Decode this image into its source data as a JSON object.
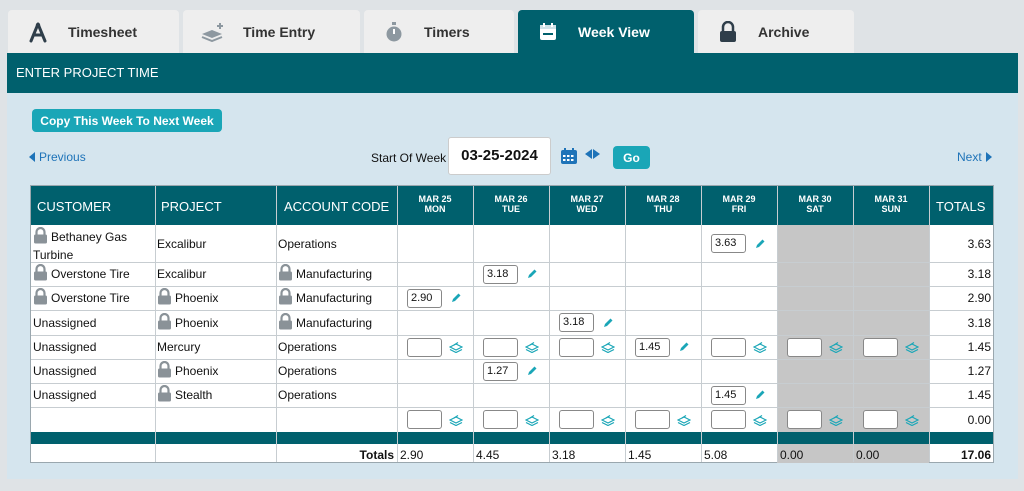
{
  "tabs": [
    {
      "label": "Timesheet",
      "icon": "compass-icon",
      "active": false
    },
    {
      "label": "Time Entry",
      "icon": "stack-plus-icon",
      "active": false
    },
    {
      "label": "Timers",
      "icon": "stopwatch-icon",
      "active": false
    },
    {
      "label": "Week View",
      "icon": "calendar-icon",
      "active": true
    },
    {
      "label": "Archive",
      "icon": "lock-icon",
      "active": false
    }
  ],
  "header": {
    "title": "ENTER PROJECT TIME"
  },
  "toolbar": {
    "copy_label": "Copy This Week To Next Week",
    "prev_label": "Previous",
    "next_label": "Next",
    "start_label": "Start Of Week",
    "start_date": "03-25-2024",
    "go_label": "Go"
  },
  "table": {
    "headers": {
      "customer": "CUSTOMER",
      "project": "PROJECT",
      "account": "ACCOUNT CODE",
      "totals": "TOTALS"
    },
    "days": [
      {
        "date": "MAR 25",
        "dow": "MON"
      },
      {
        "date": "MAR 26",
        "dow": "TUE"
      },
      {
        "date": "MAR 27",
        "dow": "WED"
      },
      {
        "date": "MAR 28",
        "dow": "THU"
      },
      {
        "date": "MAR 29",
        "dow": "FRI"
      },
      {
        "date": "MAR 30",
        "dow": "SAT"
      },
      {
        "date": "MAR 31",
        "dow": "SUN"
      }
    ],
    "rows": [
      {
        "customer": "Bethaney Gas Turbine",
        "customer_locked": true,
        "project": "Excalibur",
        "project_locked": false,
        "account": "Operations",
        "account_locked": false,
        "entries": {
          "4": "3.63"
        },
        "empty_inputs": [],
        "total": "3.63"
      },
      {
        "customer": "Overstone Tire",
        "customer_locked": true,
        "project": "Excalibur",
        "project_locked": false,
        "account": "Manufacturing",
        "account_locked": true,
        "entries": {
          "1": "3.18"
        },
        "empty_inputs": [],
        "total": "3.18"
      },
      {
        "customer": "Overstone Tire",
        "customer_locked": true,
        "project": "Phoenix",
        "project_locked": true,
        "account": "Manufacturing",
        "account_locked": true,
        "entries": {
          "0": "2.90"
        },
        "empty_inputs": [],
        "total": "2.90"
      },
      {
        "customer": "Unassigned",
        "customer_locked": false,
        "project": "Phoenix",
        "project_locked": true,
        "account": "Manufacturing",
        "account_locked": true,
        "entries": {
          "2": "3.18"
        },
        "empty_inputs": [],
        "total": "3.18"
      },
      {
        "customer": "Unassigned",
        "customer_locked": false,
        "project": "Mercury",
        "project_locked": false,
        "account": "Operations",
        "account_locked": false,
        "entries": {
          "3": "1.45"
        },
        "empty_inputs": [
          0,
          1,
          2,
          4,
          5,
          6
        ],
        "total": "1.45"
      },
      {
        "customer": "Unassigned",
        "customer_locked": false,
        "project": "Phoenix",
        "project_locked": true,
        "account": "Operations",
        "account_locked": false,
        "entries": {
          "1": "1.27"
        },
        "empty_inputs": [],
        "total": "1.27"
      },
      {
        "customer": "Unassigned",
        "customer_locked": false,
        "project": "Stealth",
        "project_locked": true,
        "account": "Operations",
        "account_locked": false,
        "entries": {
          "4": "1.45"
        },
        "empty_inputs": [],
        "total": "1.45"
      },
      {
        "customer": "",
        "customer_locked": false,
        "project": "",
        "project_locked": false,
        "account": "",
        "account_locked": false,
        "entries": {},
        "empty_inputs": [
          0,
          1,
          2,
          3,
          4,
          5,
          6
        ],
        "total": "0.00"
      }
    ],
    "footer": {
      "label": "Totals",
      "values": [
        "2.90",
        "4.45",
        "3.18",
        "1.45",
        "5.08",
        "0.00",
        "0.00"
      ],
      "grand_total": "17.06"
    }
  },
  "colors": {
    "teal": "#00606d",
    "button": "#1aa6b7",
    "link": "#1e73b8",
    "panel_bg": "#d5e5ee"
  }
}
